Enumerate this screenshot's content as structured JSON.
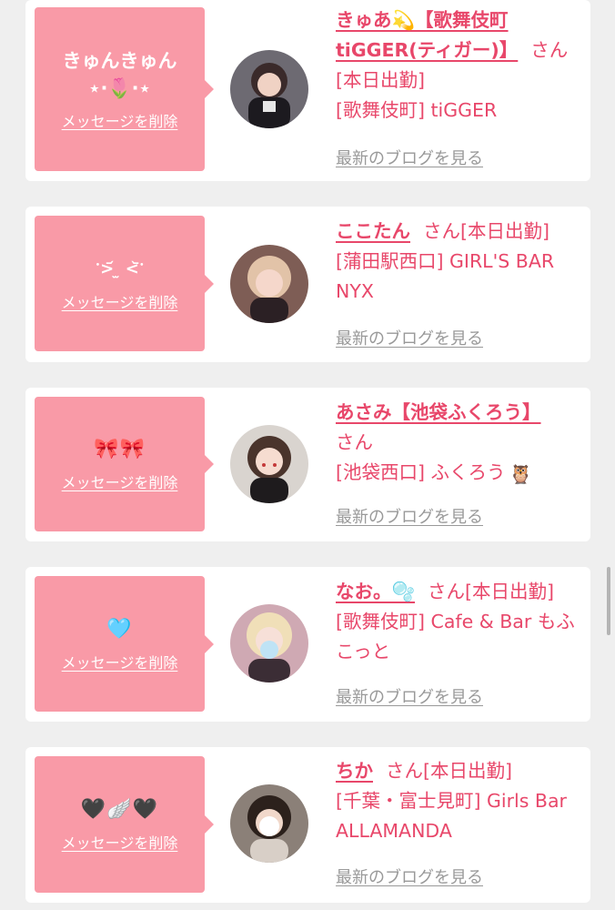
{
  "colors": {
    "accent": "#e8476a",
    "bubble": "#f99aa7",
    "muted": "#999999",
    "background": "#efefef"
  },
  "entries": [
    {
      "message": "きゅんきゅん\n⋆·🌷·⋆",
      "delete_label": "メッセージを削除",
      "name": "きゅあ💫【歌舞伎町tiGGER(ティガー)】",
      "suffix": "さん[本日出勤]",
      "shop": "[歌舞伎町] tiGGER",
      "blog_label": "最新のブログを見る",
      "avatar_icon": "girl-photo"
    },
    {
      "message": "ॱ>᷄ ̫ <᷅ॱ",
      "delete_label": "メッセージを削除",
      "name": "ここたん",
      "suffix": "さん[本日出勤]",
      "shop": "[蒲田駅西口] GIRL'S BAR NYX",
      "blog_label": "最新のブログを見る",
      "avatar_icon": "girl-photo"
    },
    {
      "message": "🎀🎀",
      "delete_label": "メッセージを削除",
      "name": "あさみ【池袋ふくろう】",
      "suffix": "さん",
      "shop": "[池袋西口] ふくろう",
      "blog_label": "最新のブログを見る",
      "avatar_icon": "girl-photo"
    },
    {
      "message": "🩵",
      "delete_label": "メッセージを削除",
      "name": "なお。🫧",
      "suffix": "さん[本日出勤]",
      "shop": "[歌舞伎町] Cafe & Bar もふこっと",
      "blog_label": "最新のブログを見る",
      "avatar_icon": "girl-photo"
    },
    {
      "message": "🖤🪽🖤",
      "delete_label": "メッセージを削除",
      "name": "ちか",
      "suffix": "さん[本日出勤]",
      "shop": "[千葉・富士見町] Girls Bar ALLAMANDA",
      "blog_label": "最新のブログを見る",
      "avatar_icon": "girl-photo"
    }
  ]
}
